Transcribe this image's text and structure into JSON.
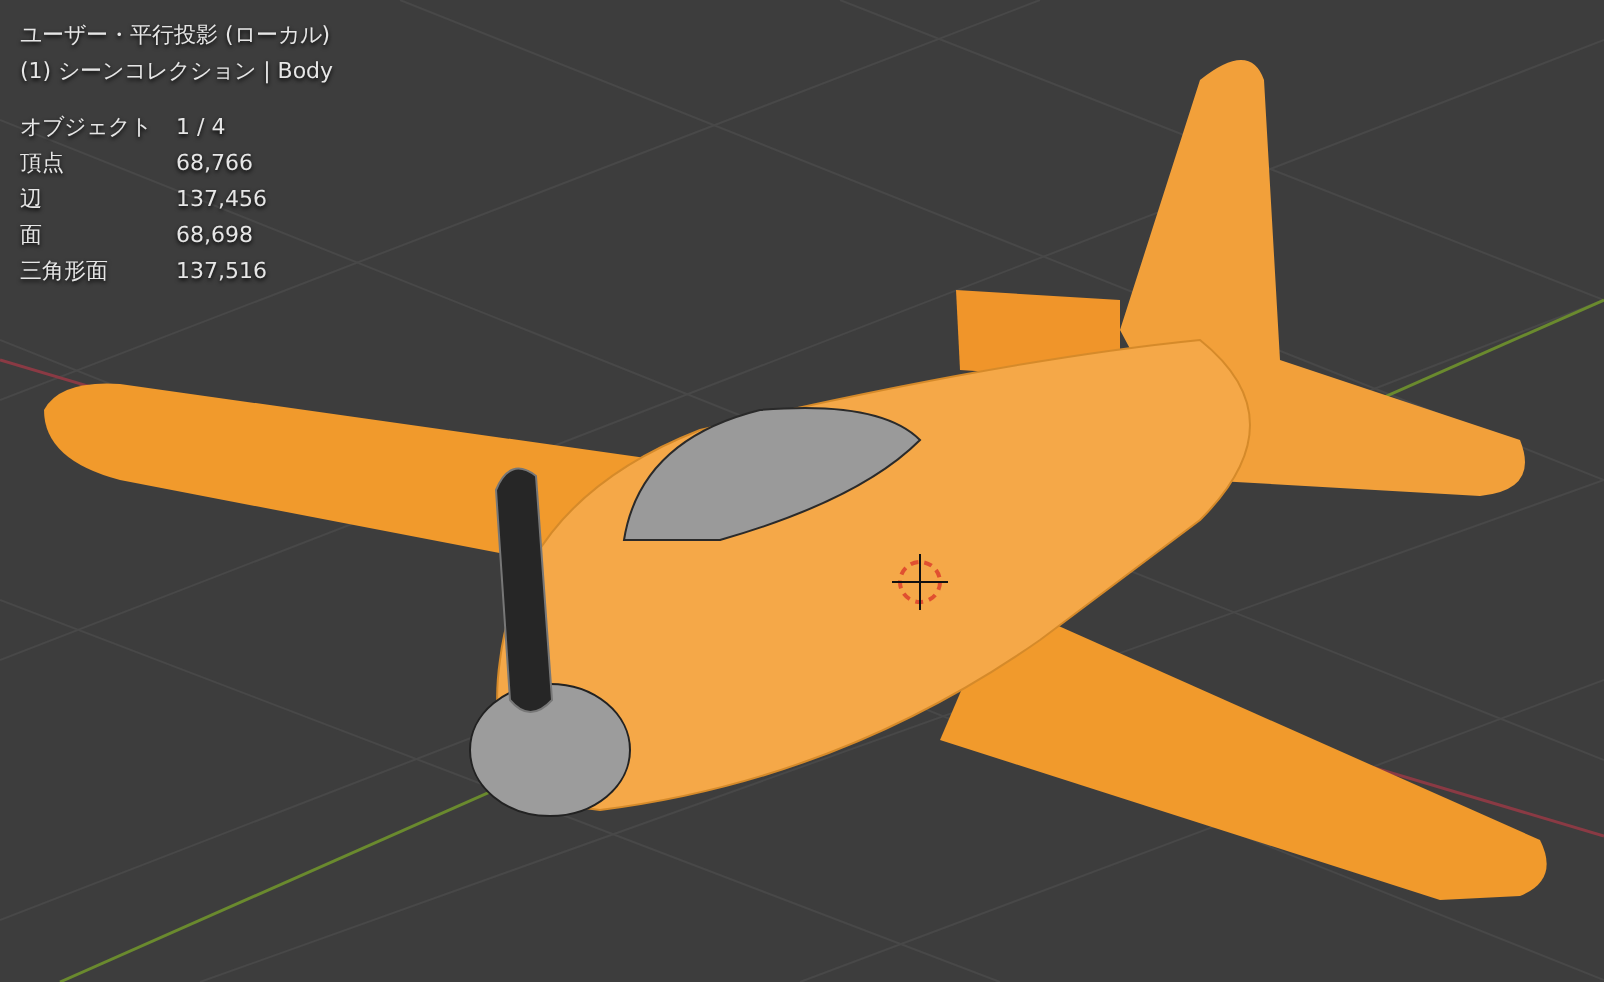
{
  "viewport": {
    "title": "ユーザー・平行投影 (ローカル)",
    "collection": "(1) シーンコレクション | Body",
    "stats": [
      {
        "label": "オブジェクト",
        "value": "1 / 4"
      },
      {
        "label": "頂点",
        "value": "68,766"
      },
      {
        "label": "辺",
        "value": "137,456"
      },
      {
        "label": "面",
        "value": "68,698"
      },
      {
        "label": "三角形面",
        "value": "137,516"
      }
    ]
  }
}
